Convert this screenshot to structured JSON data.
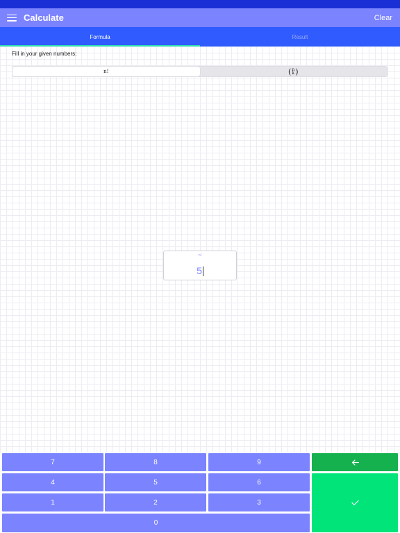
{
  "app_bar": {
    "title": "Calculate",
    "clear_label": "Clear"
  },
  "tabs": [
    {
      "label": "Formula",
      "active": true
    },
    {
      "label": "Result",
      "active": false
    }
  ],
  "content": {
    "instructions": "Fill in your given numbers:",
    "segments": [
      {
        "label": "n!",
        "selected": true
      },
      {
        "label_top": "n",
        "label_bottom": "k",
        "selected": false
      }
    ],
    "input": {
      "label": "n!",
      "value": "5"
    }
  },
  "keypad": {
    "keys": [
      "7",
      "8",
      "9",
      "4",
      "5",
      "6",
      "1",
      "2",
      "3",
      "0"
    ],
    "backspace_icon": "arrow-left-icon",
    "confirm_icon": "checkmark-icon"
  },
  "colors": {
    "status_bar": "#1a2fd6",
    "app_bar": "#7b83ff",
    "tab_bar": "#2f5bff",
    "tab_indicator": "#2ee0b0",
    "key": "#7b83ff",
    "backspace_key": "#16b14f",
    "confirm_key": "#00e47a"
  }
}
